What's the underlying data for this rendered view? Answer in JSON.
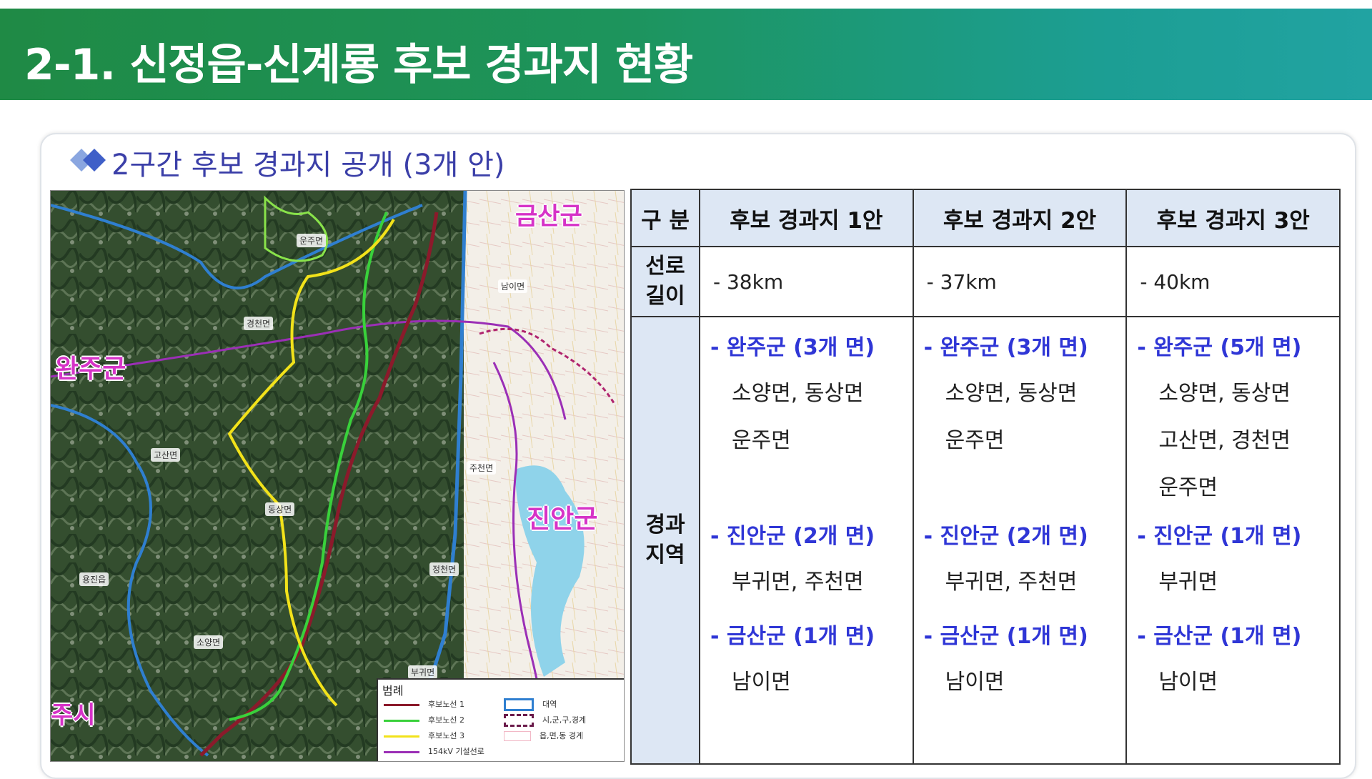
{
  "title": "2-1. 신정읍-신계룡 후보 경과지 현황",
  "subheading": "2구간 후보 경과지 공개 (3개 안)",
  "map": {
    "region_labels": {
      "wanju": "완주군",
      "geumsan": "금산군",
      "jinan": "진안군",
      "jeonju_fragment": "주시"
    },
    "place_labels": [
      "운주면",
      "경천면",
      "남이면",
      "고산면",
      "주천면",
      "동상면",
      "정천면",
      "용진읍",
      "소양면",
      "부귀면"
    ],
    "legend": {
      "title": "범례",
      "items": [
        {
          "label": "후보노선 1",
          "color": "#8b1a2b"
        },
        {
          "label": "후보노선 2",
          "color": "#39d13b"
        },
        {
          "label": "후보노선 3",
          "color": "#f2e21a"
        },
        {
          "label": "154kV 기설선로",
          "color": "#9b2fb6"
        },
        {
          "label": "대역",
          "color": "#2f7fd0"
        },
        {
          "label": "시,군,구,경계",
          "color": "#6a1a4a"
        },
        {
          "label": "읍,면,동 경계",
          "color": "#f2b8c6"
        }
      ]
    }
  },
  "table": {
    "headers": [
      "구 분",
      "후보 경과지 1안",
      "후보 경과지 2안",
      "후보 경과지 3안"
    ],
    "length_row": {
      "label_line1": "선로",
      "label_line2": "길이",
      "values": [
        "- 38km",
        "- 37km",
        "- 40km"
      ]
    },
    "region_row": {
      "label_line1": "경과",
      "label_line2": "지역",
      "plan1": {
        "wanju_head": "- 완주군 (3개 면)",
        "wanju_l1": "소양면, 동상면",
        "wanju_l2": "운주면",
        "jinan_head": "- 진안군 (2개 면)",
        "jinan_l1": "부귀면, 주천면",
        "geumsan_head": "- 금산군 (1개 면)",
        "geumsan_l1": "남이면"
      },
      "plan2": {
        "wanju_head": "- 완주군 (3개 면)",
        "wanju_l1": "소양면, 동상면",
        "wanju_l2": "운주면",
        "jinan_head": "- 진안군 (2개 면)",
        "jinan_l1": "부귀면, 주천면",
        "geumsan_head": "- 금산군 (1개 면)",
        "geumsan_l1": "남이면"
      },
      "plan3": {
        "wanju_head": "- 완주군 (5개 면)",
        "wanju_l1": "소양면, 동상면",
        "wanju_l2": "고산면, 경천면",
        "wanju_l3": "운주면",
        "jinan_head": "- 진안군 (1개 면)",
        "jinan_l1": "부귀면",
        "geumsan_head": "- 금산군 (1개 면)",
        "geumsan_l1": "남이면"
      }
    }
  }
}
